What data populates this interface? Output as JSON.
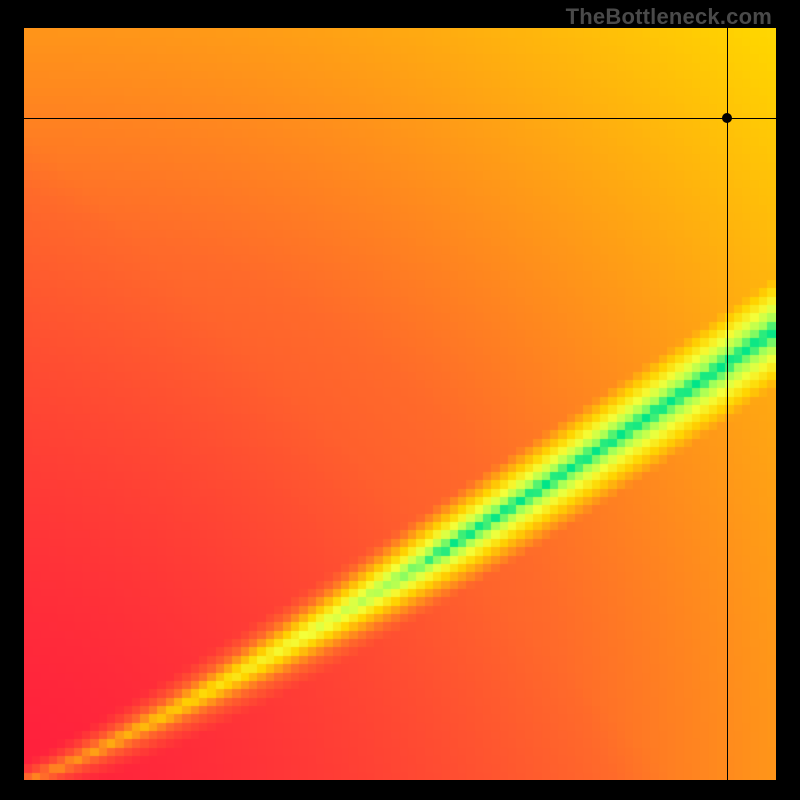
{
  "watermark": "TheBottleneck.com",
  "chart_data": {
    "type": "heatmap",
    "title": "",
    "xlabel": "",
    "ylabel": "",
    "xlim": [
      0,
      1
    ],
    "ylim": [
      0,
      1
    ],
    "colormap": {
      "stops": [
        {
          "t": 0.0,
          "color": "#ff1a3e"
        },
        {
          "t": 0.35,
          "color": "#ff6a2a"
        },
        {
          "t": 0.62,
          "color": "#ffd400"
        },
        {
          "t": 0.78,
          "color": "#f4ff3a"
        },
        {
          "t": 0.92,
          "color": "#9fff5a"
        },
        {
          "t": 1.0,
          "color": "#00e588"
        }
      ]
    },
    "optimal_curve": {
      "description": "Approximate center of the green optimal band (y ≈ 0.6·x^1.15), widening toward the right edge.",
      "points": [
        {
          "x": 0.0,
          "y": 0.0
        },
        {
          "x": 0.1,
          "y": 0.045
        },
        {
          "x": 0.2,
          "y": 0.095
        },
        {
          "x": 0.3,
          "y": 0.15
        },
        {
          "x": 0.4,
          "y": 0.21
        },
        {
          "x": 0.5,
          "y": 0.28
        },
        {
          "x": 0.6,
          "y": 0.35
        },
        {
          "x": 0.7,
          "y": 0.43
        },
        {
          "x": 0.8,
          "y": 0.51
        },
        {
          "x": 0.9,
          "y": 0.6
        },
        {
          "x": 1.0,
          "y": 0.7
        }
      ],
      "band_halfwidth_at_x0": 0.01,
      "band_halfwidth_at_x1": 0.08
    },
    "marker": {
      "x": 0.935,
      "y": 0.88
    },
    "pixelation": 90
  }
}
